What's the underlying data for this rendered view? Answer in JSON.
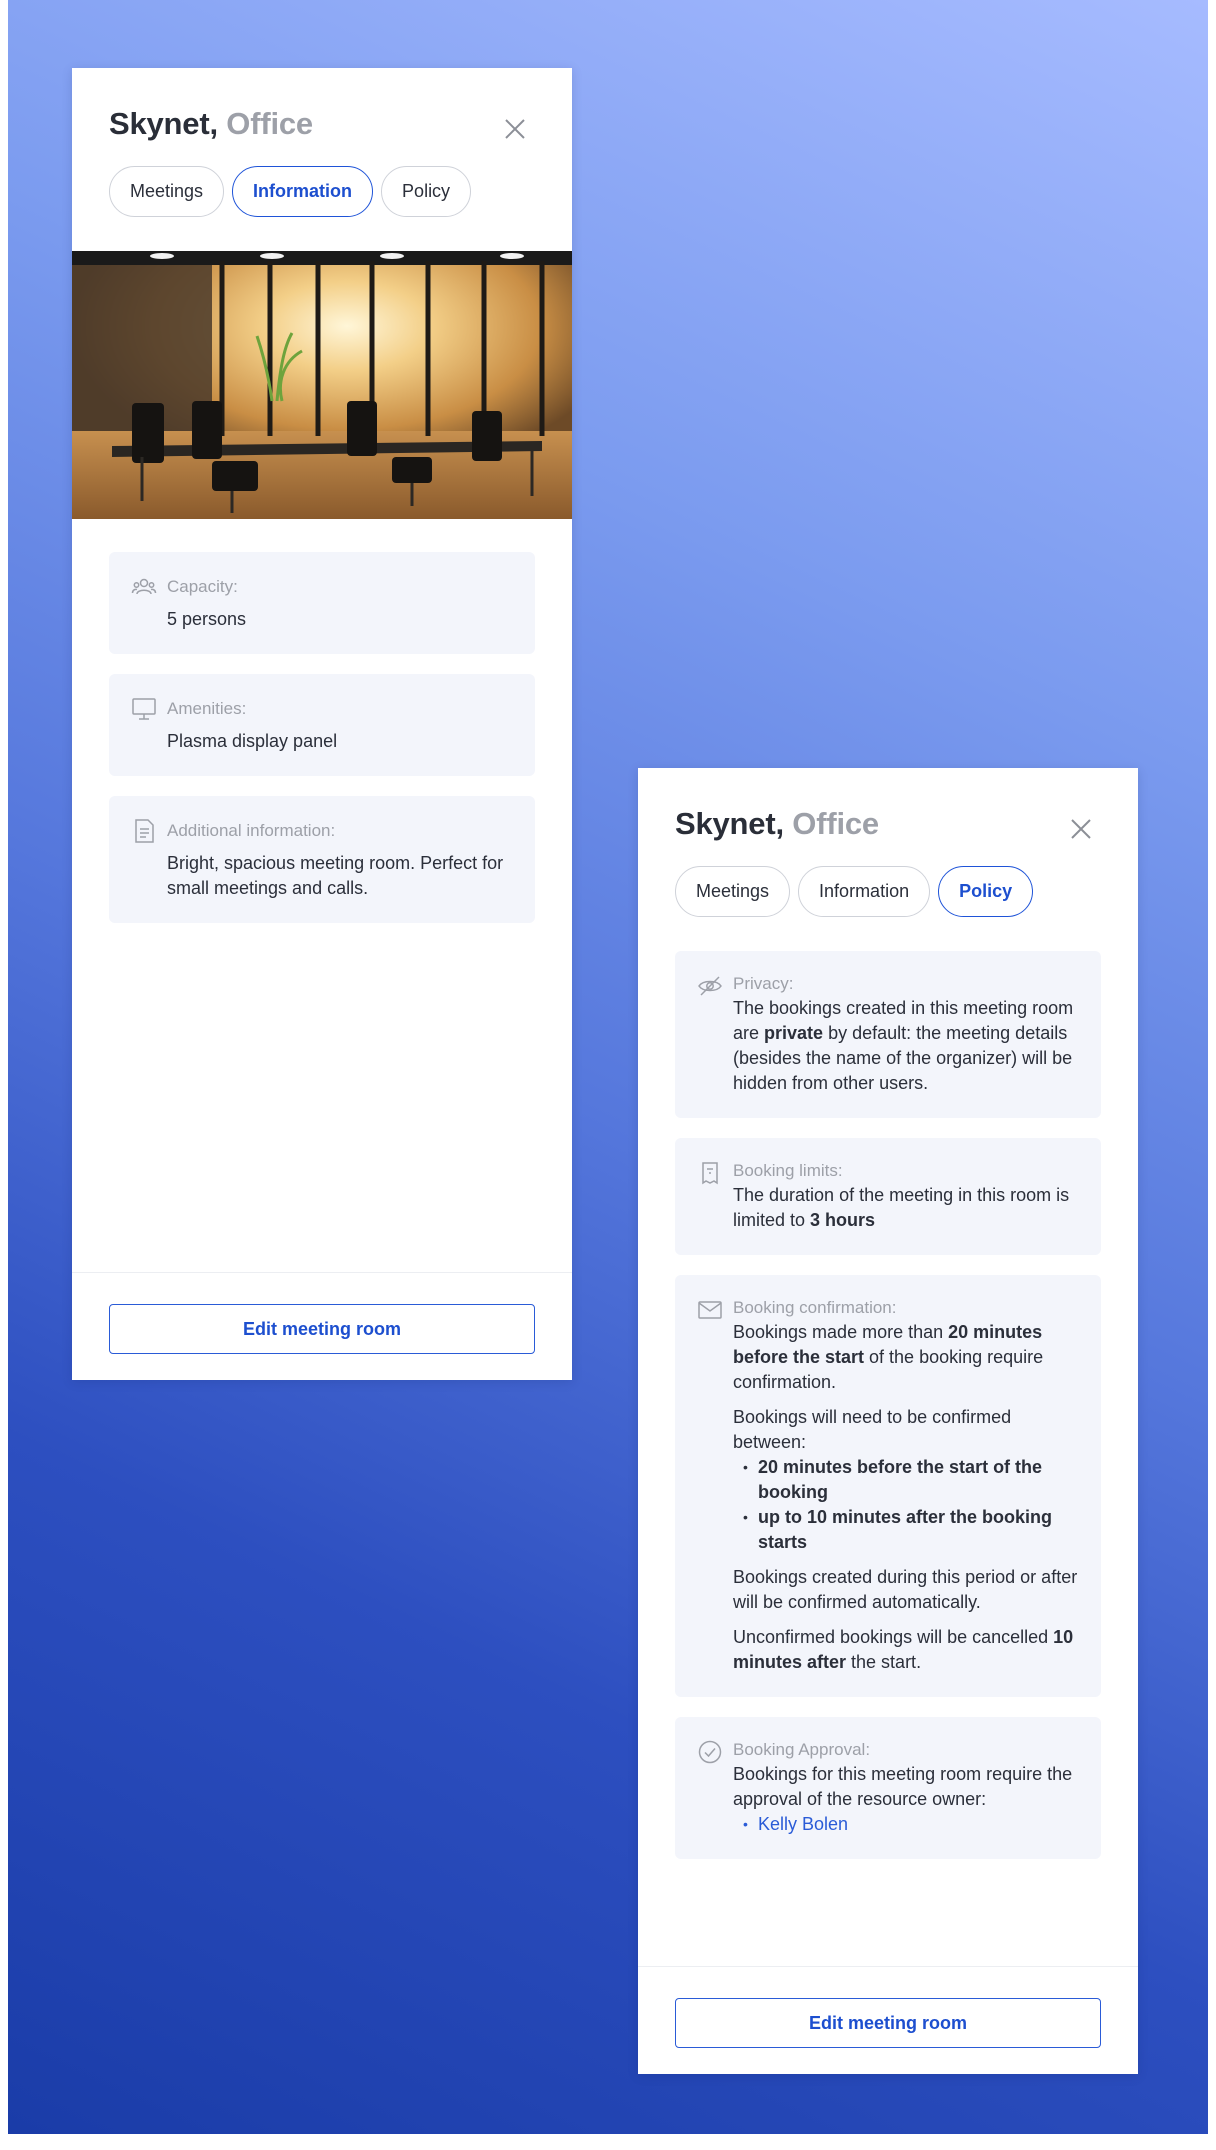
{
  "info_panel": {
    "room_name": "Skynet,",
    "room_type": "Office",
    "tabs": [
      "Meetings",
      "Information",
      "Policy"
    ],
    "active_tab": "Information",
    "photo": "meeting-room-photo",
    "capacity": {
      "label": "Capacity:",
      "value": "5 persons",
      "icon": "people-icon"
    },
    "amenities": {
      "label": "Amenities:",
      "value": "Plasma display panel",
      "icon": "monitor-icon"
    },
    "additional": {
      "label": "Additional information:",
      "value": "Bright, spacious meeting room. Perfect for small meetings and calls.",
      "icon": "document-icon"
    },
    "edit_button": "Edit meeting room"
  },
  "policy_panel": {
    "room_name": "Skynet,",
    "room_type": "Office",
    "tabs": [
      "Meetings",
      "Information",
      "Policy"
    ],
    "active_tab": "Policy",
    "privacy": {
      "label": "Privacy:",
      "icon": "eye-slash-icon",
      "text_before": "The bookings created in this meeting room are ",
      "text_bold": "private",
      "text_after": " by default: the meeting details (besides the name of the organizer) will be hidden from other users."
    },
    "limits": {
      "label": "Booking limits:",
      "icon": "receipt-icon",
      "text_before": "The duration of the meeting in this room is limited to ",
      "text_bold": "3 hours"
    },
    "confirmation": {
      "label": "Booking confirmation:",
      "icon": "envelope-icon",
      "p1_before": "Bookings made more than ",
      "p1_bold": "20 minutes before the start",
      "p1_after": " of the booking require confirmation.",
      "p2": "Bookings will need to be confirmed between:",
      "bullets": [
        "20 minutes before the start of the booking",
        "up to 10 minutes after the booking starts"
      ],
      "p3": "Bookings created during this period or after will be confirmed automatically.",
      "p4_before": "Unconfirmed bookings will be cancelled ",
      "p4_bold": "10 minutes after",
      "p4_after": " the start."
    },
    "approval": {
      "label": "Booking Approval:",
      "icon": "check-circle-icon",
      "text": "Bookings for this meeting room require the approval of the resource owner:",
      "approvers": [
        "Kelly Bolen"
      ]
    },
    "edit_button": "Edit meeting room"
  },
  "colors": {
    "accent": "#1d4fcf",
    "card_bg": "#f3f5fb",
    "muted_text": "#9da0a8",
    "background_top": "#a6bbff",
    "background_bottom": "#1a3ca8"
  }
}
